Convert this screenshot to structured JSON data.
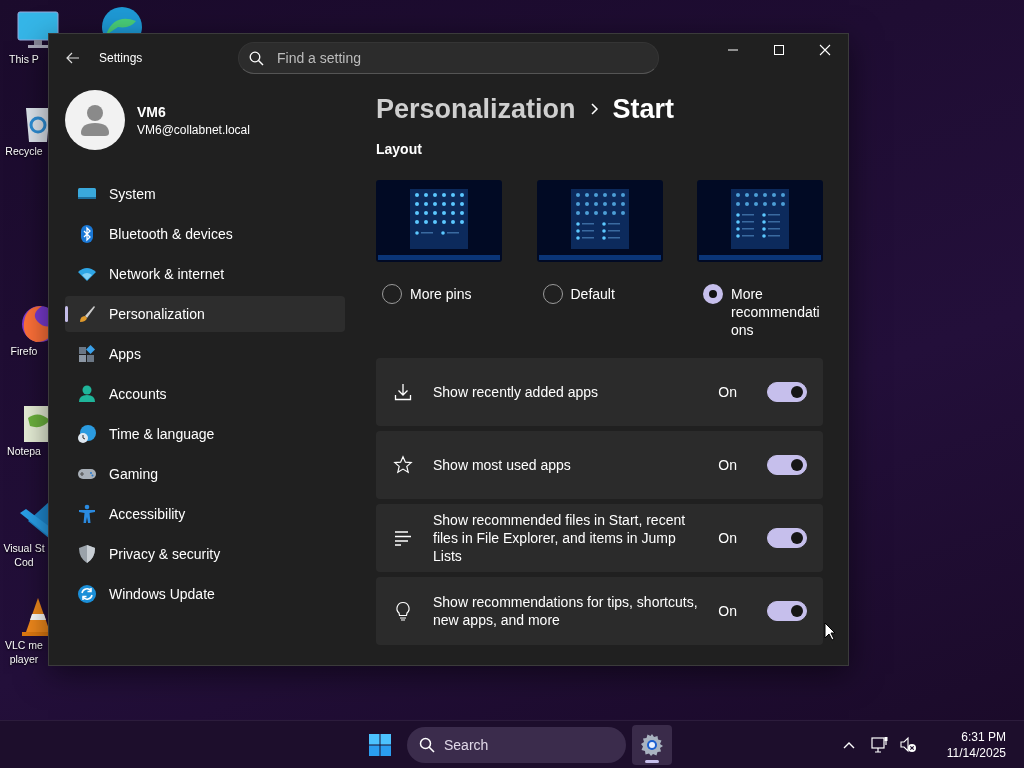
{
  "desktop_icons": [
    {
      "label_lines": [
        "This P"
      ]
    },
    {
      "label_lines": [
        "Recycle"
      ]
    },
    {
      "label_lines": [
        "Firefo"
      ]
    },
    {
      "label_lines": [
        "Notepa"
      ]
    },
    {
      "label_lines": [
        "Visual St",
        "Cod"
      ]
    },
    {
      "label_lines": [
        "VLC me",
        "player"
      ]
    }
  ],
  "window": {
    "title": "Settings",
    "search": {
      "placeholder": "Find a setting"
    }
  },
  "profile": {
    "name": "VM6",
    "email": "VM6@collabnet.local"
  },
  "nav": [
    {
      "label": "System",
      "selected": false
    },
    {
      "label": "Bluetooth & devices",
      "selected": false
    },
    {
      "label": "Network & internet",
      "selected": false
    },
    {
      "label": "Personalization",
      "selected": true
    },
    {
      "label": "Apps",
      "selected": false
    },
    {
      "label": "Accounts",
      "selected": false
    },
    {
      "label": "Time & language",
      "selected": false
    },
    {
      "label": "Gaming",
      "selected": false
    },
    {
      "label": "Accessibility",
      "selected": false
    },
    {
      "label": "Privacy & security",
      "selected": false
    },
    {
      "label": "Windows Update",
      "selected": false
    }
  ],
  "breadcrumb": [
    "Personalization",
    "Start"
  ],
  "layout": {
    "heading": "Layout",
    "options": [
      {
        "label": "More pins",
        "kind": "pins",
        "selected": false
      },
      {
        "label": "Default",
        "kind": "default",
        "selected": false
      },
      {
        "label": "More recommendations",
        "kind": "recommendations",
        "selected": true
      }
    ]
  },
  "settings": [
    {
      "label": "Show recently added apps",
      "state_text": "On",
      "on": true
    },
    {
      "label": "Show most used apps",
      "state_text": "On",
      "on": true
    },
    {
      "label": "Show recommended files in Start, recent files in File Explorer, and items in Jump Lists",
      "state_text": "On",
      "on": true
    },
    {
      "label": "Show recommendations for tips, shortcuts, new apps, and more",
      "state_text": "On",
      "on": true
    }
  ],
  "taskbar": {
    "search": {
      "placeholder": "Search"
    },
    "apps": [
      {
        "running": true
      }
    ],
    "clock": {
      "time": "6:31 PM",
      "date": "11/14/2025"
    }
  }
}
